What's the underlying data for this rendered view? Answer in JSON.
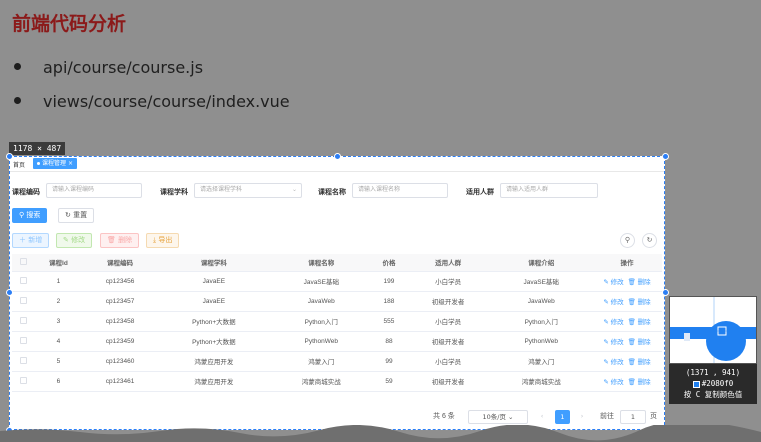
{
  "slide": {
    "title": "前端代码分析",
    "bullets": [
      "api/course/course.js",
      "views/course/course/index.vue"
    ]
  },
  "selection": {
    "size_label": "1178 × 487"
  },
  "app": {
    "tabs": {
      "home": "首页",
      "active": "课程管理",
      "close": "×"
    },
    "filters": {
      "code_label": "课程编码",
      "code_placeholder": "请输入课程编码",
      "subject_label": "课程学科",
      "subject_placeholder": "请选择课程学科",
      "name_label": "课程名称",
      "name_placeholder": "请输入课程名称",
      "audience_label": "适用人群",
      "audience_placeholder": "请输入适用人群"
    },
    "buttons": {
      "search": "搜索",
      "reset": "重置",
      "add": "新增",
      "edit": "修改",
      "delete": "删除",
      "export": "导出"
    },
    "table": {
      "headers": [
        "课程Id",
        "课程编码",
        "课程学科",
        "课程名称",
        "价格",
        "适用人群",
        "课程介绍",
        "操作"
      ],
      "rows": [
        [
          "1",
          "cp123456",
          "JavaEE",
          "JavaSE基础",
          "199",
          "小白学员",
          "JavaSE基础"
        ],
        [
          "2",
          "cp123457",
          "JavaEE",
          "JavaWeb",
          "188",
          "初级开发者",
          "JavaWeb"
        ],
        [
          "3",
          "cp123458",
          "Python+大数据",
          "Python入门",
          "555",
          "小白学员",
          "Python入门"
        ],
        [
          "4",
          "cp123459",
          "Python+大数据",
          "PythonWeb",
          "88",
          "初级开发者",
          "PythonWeb"
        ],
        [
          "5",
          "cp123460",
          "鸿蒙应用开发",
          "鸿蒙入门",
          "99",
          "小白学员",
          "鸿蒙入门"
        ],
        [
          "6",
          "cp123461",
          "鸿蒙应用开发",
          "鸿蒙商城实战",
          "59",
          "初级开发者",
          "鸿蒙商城实战"
        ]
      ],
      "row_edit": "修改",
      "row_delete": "删除"
    },
    "pagination": {
      "total": "共 6 条",
      "page_size": "10条/页",
      "current_page": "1",
      "goto_label": "前往",
      "goto_value": "1",
      "page_unit": "页"
    }
  },
  "color_picker": {
    "coords": "(1371 , 941)",
    "hex": "#2080f0",
    "hint": "按 C 复制颜色值"
  }
}
